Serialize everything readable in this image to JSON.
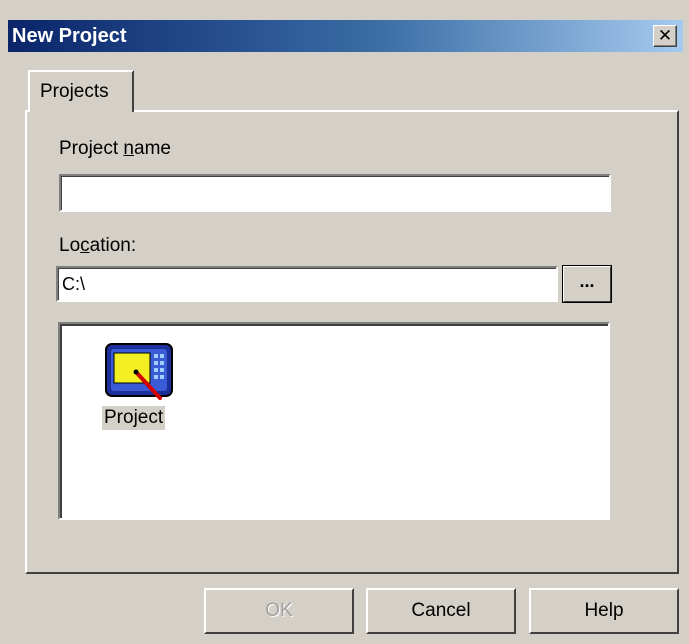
{
  "window": {
    "title": "New Project",
    "close_glyph": "✕"
  },
  "tabs": [
    {
      "label": "Projects",
      "selected": true
    }
  ],
  "form": {
    "project_name": {
      "label": "Project name",
      "value": ""
    },
    "location": {
      "label": "Location:",
      "value": "C:\\",
      "browse_label": "..."
    }
  },
  "project_types": {
    "items": [
      {
        "label": "Project",
        "icon": "monitor-project-icon",
        "selected": true
      }
    ]
  },
  "buttons": {
    "ok": {
      "label": "OK",
      "enabled": false
    },
    "cancel": {
      "label": "Cancel",
      "enabled": true
    },
    "help": {
      "label": "Help",
      "enabled": true
    }
  },
  "colors": {
    "titlebar_start": "#0a246a",
    "titlebar_end": "#a6caf0",
    "face": "#d4d0c8"
  }
}
